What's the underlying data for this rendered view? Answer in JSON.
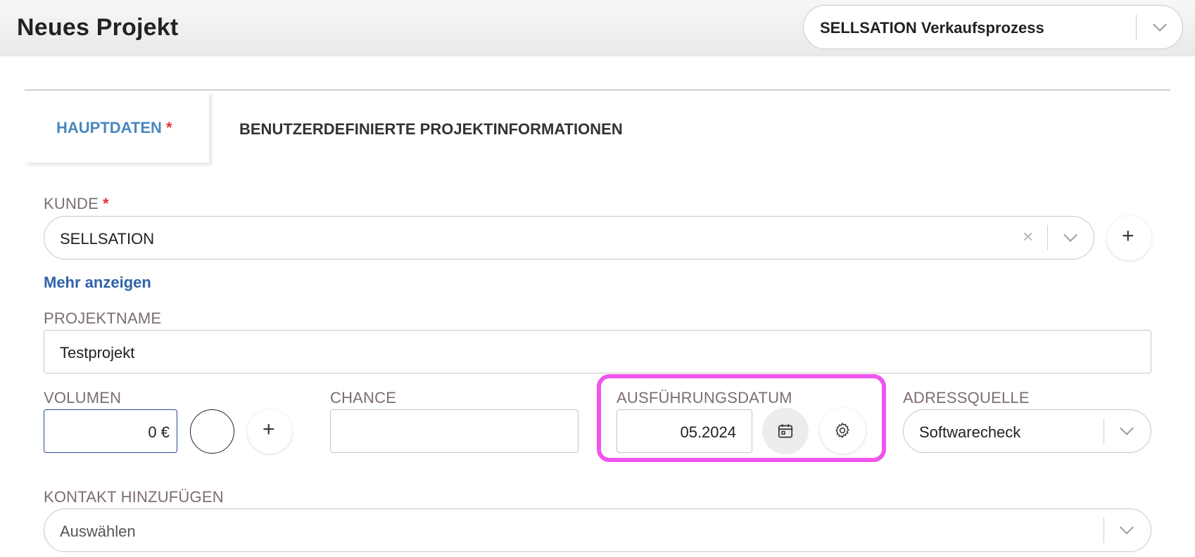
{
  "header": {
    "title": "Neues Projekt",
    "process_select_value": "SELLSATION Verkaufsprozess"
  },
  "tabs": [
    {
      "label": "HAUPTDATEN",
      "required_mark": "*",
      "active": true
    },
    {
      "label": "BENUTZERDEFINIERTE PROJEKTINFORMATIONEN",
      "active": false
    }
  ],
  "customer": {
    "label": "KUNDE",
    "required_mark": "*",
    "value": "SELLSATION",
    "clear_icon": "×",
    "add_icon": "+"
  },
  "more_link": "Mehr anzeigen",
  "project_name": {
    "label": "PROJEKTNAME",
    "value": "Testprojekt"
  },
  "volume": {
    "label": "VOLUMEN",
    "value": "0 €",
    "add_icon": "+"
  },
  "chance": {
    "label": "CHANCE",
    "value": ""
  },
  "execution_date": {
    "label": "AUSFÜHRUNGSDATUM",
    "value": "05.2024",
    "calendar_icon": "calendar-icon",
    "settings_icon": "gear-icon"
  },
  "address_source": {
    "label": "ADRESSQUELLE",
    "value": "Softwarecheck"
  },
  "contact": {
    "label": "KONTAKT HINZUFÜGEN",
    "placeholder": "Auswählen"
  },
  "colors": {
    "accent_tab": "#4a87c0",
    "link": "#2f63a8",
    "required": "#e03434",
    "highlight": "#ee55ee",
    "focused_border": "#2b4aa0"
  }
}
